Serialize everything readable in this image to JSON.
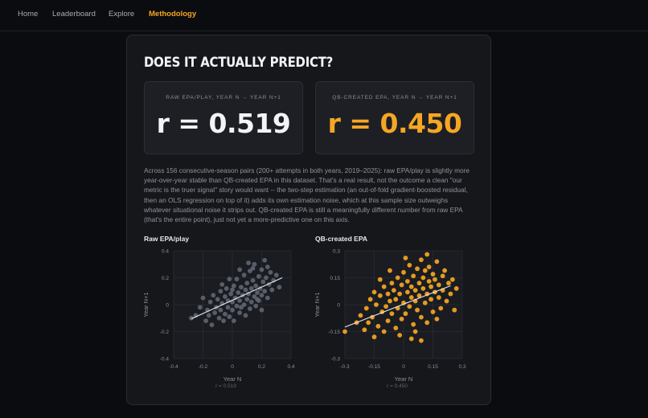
{
  "nav": {
    "items": [
      {
        "label": "Home",
        "active": false
      },
      {
        "label": "Leaderboard",
        "active": false
      },
      {
        "label": "Explore",
        "active": false
      },
      {
        "label": "Methodology",
        "active": true
      }
    ]
  },
  "card": {
    "title": "DOES IT ACTUALLY PREDICT?",
    "stats": [
      {
        "label": "RAW EPA/PLAY, YEAR N → YEAR N+1",
        "value": "r = 0.519"
      },
      {
        "label": "QB-CREATED EPA, YEAR N → YEAR N+1",
        "value": "r = 0.450"
      }
    ],
    "description": "Across 156 consecutive-season pairs (200+ attempts in both years, 2019–2025): raw EPA/play is slightly more year-over-year stable than QB-created EPA in this dataset. That's a real result, not the outcome a clean \"our metric is the truer signal\" story would want -- the two-step estimation (an out-of-fold gradient-boosted residual, then an OLS regression on top of it) adds its own estimation noise, which at this sample size outweighs whatever situational noise it strips out. QB-created EPA is still a meaningfully different number from raw EPA (that's the entire point), just not yet a more-predictive one on this axis."
  },
  "colors": {
    "accent": "#f5a623",
    "raw_points": "#5d6470",
    "fit_line": "#e8e9ec",
    "background": "#0b0c0f",
    "card": "#16171b"
  },
  "chart_data": [
    {
      "type": "scatter",
      "title": "Raw EPA/play",
      "ylabel": "Year N+1",
      "xlabel": "Year N",
      "xlim": [
        -0.4,
        0.4
      ],
      "ylim": [
        -0.4,
        0.4
      ],
      "xticks": [
        "-0.4",
        "-0.2",
        "0",
        "0.2",
        "0.4"
      ],
      "yticks": [
        "0.4",
        "0.2",
        "0",
        "-0.2",
        "-0.4"
      ],
      "grid": true,
      "annotation": "r = 0.519",
      "fit_line": {
        "x": [
          -0.28,
          0.34
        ],
        "y": [
          -0.105,
          0.2
        ]
      },
      "point_color": "#5d6470",
      "points": [
        [
          -0.28,
          -0.1
        ],
        [
          -0.25,
          -0.08
        ],
        [
          -0.22,
          -0.02
        ],
        [
          -0.2,
          0.05
        ],
        [
          -0.18,
          -0.12
        ],
        [
          -0.17,
          -0.04
        ],
        [
          -0.15,
          0.02
        ],
        [
          -0.14,
          -0.15
        ],
        [
          -0.13,
          0.07
        ],
        [
          -0.12,
          -0.06
        ],
        [
          -0.11,
          -0.02
        ],
        [
          -0.1,
          0.04
        ],
        [
          -0.09,
          -0.1
        ],
        [
          -0.08,
          0.1
        ],
        [
          -0.08,
          -0.04
        ],
        [
          -0.07,
          0.01
        ],
        [
          -0.06,
          -0.12
        ],
        [
          -0.05,
          0.06
        ],
        [
          -0.05,
          -0.07
        ],
        [
          -0.04,
          0.12
        ],
        [
          -0.03,
          -0.02
        ],
        [
          -0.03,
          0.03
        ],
        [
          -0.02,
          -0.09
        ],
        [
          -0.01,
          0.08
        ],
        [
          0.0,
          -0.04
        ],
        [
          0.0,
          0.02
        ],
        [
          0.01,
          0.14
        ],
        [
          0.01,
          -0.12
        ],
        [
          0.02,
          0.05
        ],
        [
          0.03,
          -0.01
        ],
        [
          0.03,
          0.19
        ],
        [
          0.04,
          0.09
        ],
        [
          0.05,
          -0.06
        ],
        [
          0.05,
          0.03
        ],
        [
          0.06,
          0.13
        ],
        [
          0.06,
          -0.02
        ],
        [
          0.07,
          0.07
        ],
        [
          0.08,
          0.22
        ],
        [
          0.08,
          0.0
        ],
        [
          0.09,
          0.11
        ],
        [
          0.09,
          -0.08
        ],
        [
          0.1,
          0.04
        ],
        [
          0.1,
          0.16
        ],
        [
          0.11,
          0.08
        ],
        [
          0.12,
          -0.03
        ],
        [
          0.12,
          0.25
        ],
        [
          0.13,
          0.12
        ],
        [
          0.13,
          0.02
        ],
        [
          0.14,
          0.18
        ],
        [
          0.15,
          0.06
        ],
        [
          0.15,
          0.3
        ],
        [
          0.16,
          -0.01
        ],
        [
          0.16,
          0.14
        ],
        [
          0.17,
          0.09
        ],
        [
          0.18,
          0.21
        ],
        [
          0.18,
          0.03
        ],
        [
          0.19,
          0.12
        ],
        [
          0.2,
          0.26
        ],
        [
          0.2,
          0.07
        ],
        [
          0.21,
          0.17
        ],
        [
          0.22,
          0.1
        ],
        [
          0.22,
          0.33
        ],
        [
          0.23,
          0.2
        ],
        [
          0.24,
          0.05
        ],
        [
          0.25,
          0.15
        ],
        [
          0.26,
          0.24
        ],
        [
          0.27,
          0.11
        ],
        [
          0.28,
          0.18
        ],
        [
          0.3,
          0.22
        ],
        [
          0.32,
          0.13
        ],
        [
          0.05,
          0.26
        ],
        [
          -0.02,
          0.19
        ],
        [
          0.11,
          0.31
        ],
        [
          -0.16,
          -0.08
        ],
        [
          0.2,
          -0.04
        ],
        [
          0.14,
          0.27
        ],
        [
          -0.07,
          0.15
        ],
        [
          0.24,
          0.28
        ],
        [
          0.0,
          0.11
        ],
        [
          0.17,
          0.04
        ]
      ]
    },
    {
      "type": "scatter",
      "title": "QB-created EPA",
      "ylabel": "Year N+1",
      "xlabel": "Year N",
      "xlim": [
        -0.3,
        0.3
      ],
      "ylim": [
        -0.3,
        0.3
      ],
      "xticks": [
        "-0.3",
        "-0.15",
        "0",
        "0.15",
        "0.3"
      ],
      "yticks": [
        "0.3",
        "0.15",
        "0",
        "-0.15",
        "-0.3"
      ],
      "grid": true,
      "annotation": "r = 0.450",
      "fit_line": {
        "x": [
          -0.3,
          0.24
        ],
        "y": [
          -0.125,
          0.105
        ]
      },
      "point_color": "#f5a623",
      "points": [
        [
          -0.3,
          -0.15
        ],
        [
          -0.24,
          -0.1
        ],
        [
          -0.22,
          -0.06
        ],
        [
          -0.2,
          -0.14
        ],
        [
          -0.19,
          -0.02
        ],
        [
          -0.18,
          -0.1
        ],
        [
          -0.17,
          0.03
        ],
        [
          -0.16,
          -0.07
        ],
        [
          -0.15,
          -0.18
        ],
        [
          -0.14,
          0.0
        ],
        [
          -0.13,
          -0.12
        ],
        [
          -0.12,
          0.05
        ],
        [
          -0.11,
          -0.04
        ],
        [
          -0.1,
          0.1
        ],
        [
          -0.1,
          -0.15
        ],
        [
          -0.09,
          -0.01
        ],
        [
          -0.08,
          0.06
        ],
        [
          -0.08,
          -0.09
        ],
        [
          -0.07,
          0.02
        ],
        [
          -0.06,
          0.12
        ],
        [
          -0.06,
          -0.05
        ],
        [
          -0.05,
          0.08
        ],
        [
          -0.04,
          -0.13
        ],
        [
          -0.04,
          0.03
        ],
        [
          -0.03,
          0.15
        ],
        [
          -0.03,
          -0.02
        ],
        [
          -0.02,
          0.06
        ],
        [
          -0.01,
          -0.08
        ],
        [
          -0.01,
          0.11
        ],
        [
          0.0,
          0.01
        ],
        [
          0.0,
          0.18
        ],
        [
          0.01,
          -0.05
        ],
        [
          0.02,
          0.07
        ],
        [
          0.02,
          0.13
        ],
        [
          0.03,
          -0.01
        ],
        [
          0.03,
          0.22
        ],
        [
          0.04,
          0.04
        ],
        [
          0.04,
          0.1
        ],
        [
          0.05,
          -0.11
        ],
        [
          0.05,
          0.16
        ],
        [
          0.06,
          0.02
        ],
        [
          0.06,
          0.08
        ],
        [
          0.07,
          0.2
        ],
        [
          0.07,
          -0.03
        ],
        [
          0.08,
          0.12
        ],
        [
          0.08,
          0.05
        ],
        [
          0.09,
          0.25
        ],
        [
          0.09,
          -0.07
        ],
        [
          0.1,
          0.09
        ],
        [
          0.1,
          0.15
        ],
        [
          0.11,
          0.01
        ],
        [
          0.11,
          0.19
        ],
        [
          0.12,
          0.06
        ],
        [
          0.12,
          -0.1
        ],
        [
          0.13,
          0.13
        ],
        [
          0.13,
          0.21
        ],
        [
          0.14,
          0.03
        ],
        [
          0.14,
          0.1
        ],
        [
          0.15,
          0.17
        ],
        [
          0.15,
          -0.04
        ],
        [
          0.16,
          0.07
        ],
        [
          0.16,
          0.14
        ],
        [
          0.17,
          0.24
        ],
        [
          0.18,
          0.04
        ],
        [
          0.18,
          0.11
        ],
        [
          0.19,
          -0.02
        ],
        [
          0.2,
          0.16
        ],
        [
          0.2,
          0.08
        ],
        [
          0.21,
          0.19
        ],
        [
          0.22,
          0.02
        ],
        [
          0.23,
          0.12
        ],
        [
          0.24,
          0.06
        ],
        [
          0.25,
          0.14
        ],
        [
          0.26,
          -0.03
        ],
        [
          0.27,
          0.09
        ],
        [
          -0.02,
          -0.17
        ],
        [
          0.01,
          0.26
        ],
        [
          0.06,
          -0.15
        ],
        [
          -0.12,
          0.14
        ],
        [
          0.12,
          0.28
        ],
        [
          0.04,
          -0.19
        ],
        [
          -0.07,
          0.19
        ],
        [
          0.17,
          -0.08
        ],
        [
          0.09,
          -0.2
        ],
        [
          -0.15,
          0.07
        ]
      ]
    }
  ]
}
